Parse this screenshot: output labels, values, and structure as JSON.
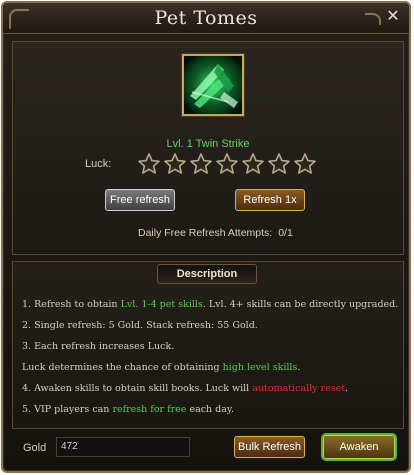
{
  "window": {
    "title": "Pet Tomes",
    "close_icon": "✕"
  },
  "skill": {
    "name": "Lvl. 1 Twin Strike",
    "icon": "twin-strike-skill-icon"
  },
  "luck": {
    "label": "Luck:",
    "filled": 0,
    "total": 7
  },
  "buttons": {
    "free_refresh": "Free refresh",
    "refresh_1x": "Refresh 1x",
    "bulk_refresh": "Bulk Refresh",
    "awaken": "Awaken"
  },
  "attempts": {
    "label": "Daily Free Refresh Attempts:",
    "value": "0/1"
  },
  "description": {
    "title": "Description",
    "lines": [
      [
        {
          "t": "1. Refresh to obtain "
        },
        {
          "t": "Lvl. 1-4 pet skills",
          "c": "green"
        },
        {
          "t": ". Lvl. 4+ skills can be directly upgraded."
        }
      ],
      [
        {
          "t": "2. Single refresh: 5 Gold. Stack refresh: 55 Gold."
        }
      ],
      [
        {
          "t": "3. Each refresh increases Luck."
        }
      ],
      [
        {
          "t": "Luck determines the chance of obtaining "
        },
        {
          "t": "high level skills",
          "c": "green"
        },
        {
          "t": "."
        }
      ],
      [
        {
          "t": "4. Awaken skills to obtain skill books. Luck will "
        },
        {
          "t": "automatically reset",
          "c": "red"
        },
        {
          "t": "."
        }
      ],
      [
        {
          "t": "5. VIP players can "
        },
        {
          "t": "refresh for free",
          "c": "green"
        },
        {
          "t": " each day."
        }
      ]
    ]
  },
  "gold": {
    "label": "Gold",
    "value": "472"
  },
  "colors": {
    "accent_gold": "#c9a85c",
    "text_green": "#56cc56",
    "text_red": "#e03030"
  }
}
